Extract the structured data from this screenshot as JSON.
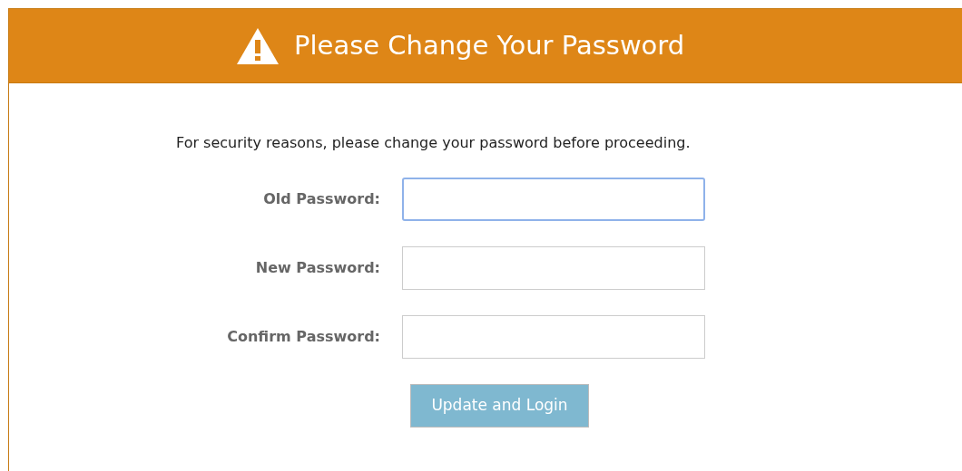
{
  "header": {
    "title": "Please Change Your Password"
  },
  "message": "For security reasons, please change your password before proceeding.",
  "fields": [
    {
      "label": "Old Password:",
      "focused": true
    },
    {
      "label": "New Password:",
      "focused": false
    },
    {
      "label": "Confirm Password:",
      "focused": false
    }
  ],
  "submit_button": {
    "label": "Update and Login"
  }
}
